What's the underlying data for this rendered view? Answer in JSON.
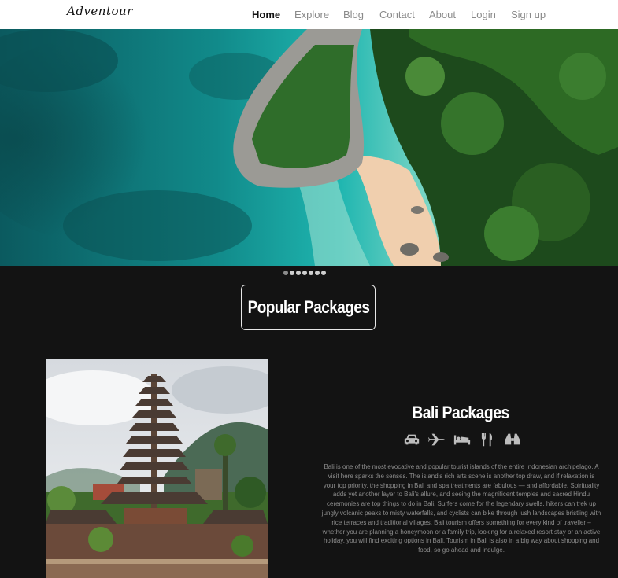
{
  "nav": {
    "logo": "Adventour",
    "links": [
      {
        "label": "Home",
        "active": true
      },
      {
        "label": "Explore",
        "active": false
      },
      {
        "label": "Blog",
        "active": false
      },
      {
        "label": "Contact",
        "active": false
      },
      {
        "label": "About",
        "active": false
      },
      {
        "label": "Login",
        "active": false
      },
      {
        "label": "Sign up",
        "active": false
      }
    ]
  },
  "carousel": {
    "slide_count": 7,
    "active_index": 0
  },
  "section": {
    "title": "Popular Packages"
  },
  "package": {
    "title": "Bali Packages",
    "amenities": [
      "car-icon",
      "plane-icon",
      "bed-icon",
      "utensils-icon",
      "binoculars-icon"
    ],
    "description": "Bali is one of the most evocative and popular tourist islands of the entire Indonesian archipelago. A visit here sparks the senses. The island's rich arts scene is another top draw, and if relaxation is your top priority, the shopping in Bali and spa treatments are fabulous — and affordable. Spirituality adds yet another layer to Bali's allure, and seeing the magnificent temples and sacred Hindu ceremonies are top things to do in Bali. Surfers come for the legendary swells, hikers can trek up jungly volcanic peaks to misty waterfalls, and cyclists can bike through lush landscapes bristling with rice terraces and traditional villages. Bali tourism offers something for every kind of traveller – whether you are planning a honeymoon or a family trip, looking for a relaxed resort stay or an active holiday, you will find exciting options in Bali. Tourism in Bali is also in a big way about shopping and food, so go ahead and indulge."
  },
  "colors": {
    "background": "#131313",
    "nav_bg": "#ffffff",
    "nav_active": "#111111",
    "nav_inactive": "#8a8a8a",
    "text_light": "#ffffff",
    "text_muted": "#8e8e8e",
    "icon": "#bdbdbd"
  }
}
